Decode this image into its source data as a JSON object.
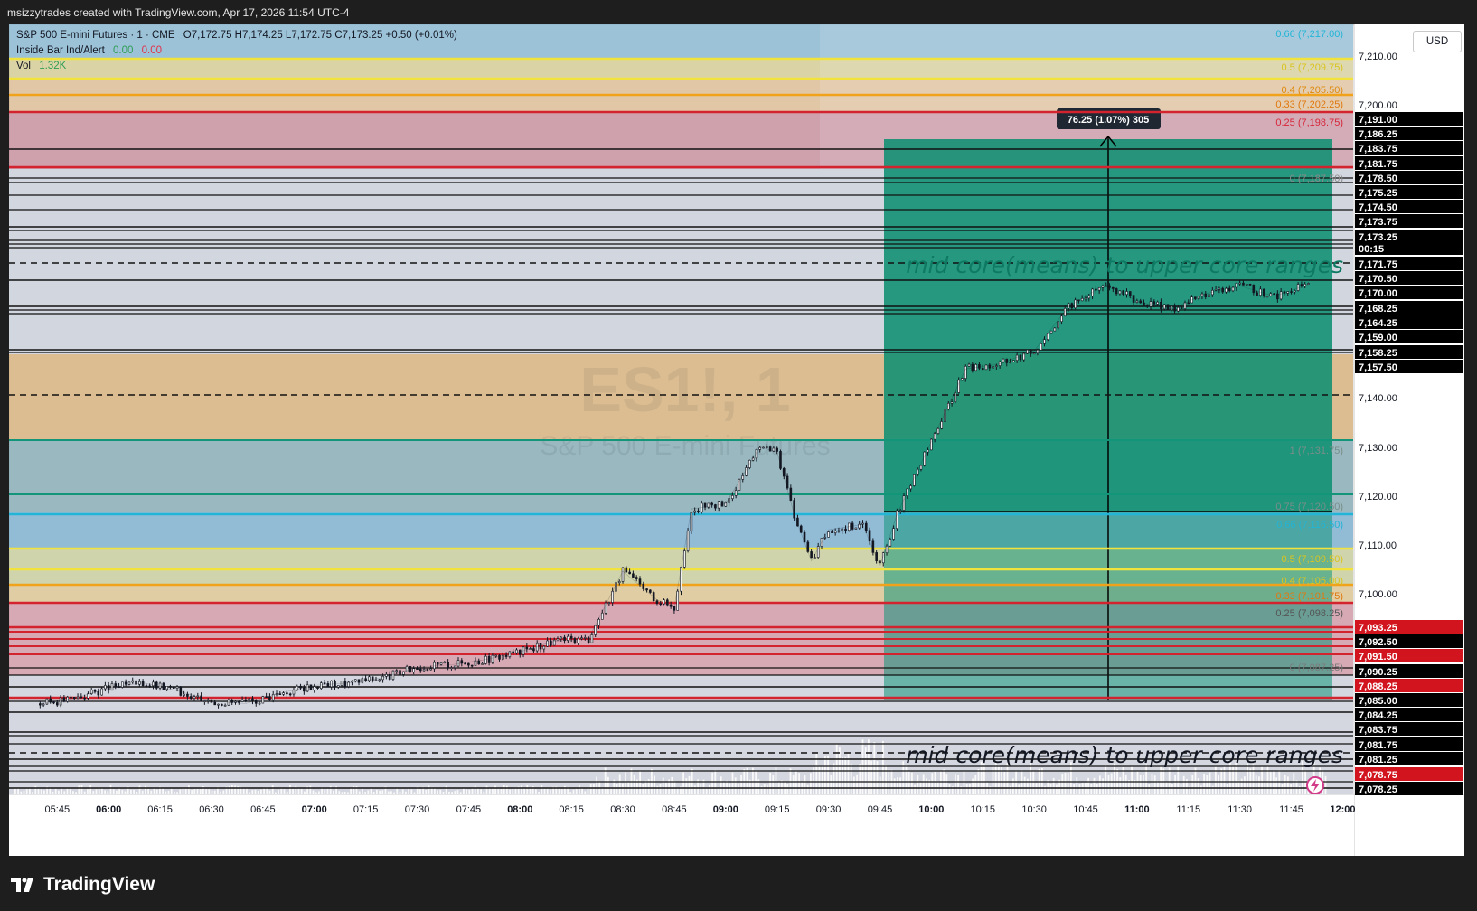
{
  "header": {
    "attribution": "msizzytrades created with TradingView.com, Apr 17, 2026 11:54 UTC-4"
  },
  "legend": {
    "symbol_line": "S&P 500 E-mini Futures · 1 · CME",
    "ohlc": "O7,172.75  H7,174.25  L7,172.75  C7,173.25  +0.50 (+0.01%)",
    "indicator_name": "Inside Bar Ind/Alert",
    "indicator_v1": "0.00",
    "indicator_v2": "0.00",
    "vol_label": "Vol",
    "vol_value": "1.32K"
  },
  "currency_button": "USD",
  "watermark": {
    "ticker": "ES1!, 1",
    "name": "S&P 500 E-mini Futures"
  },
  "position_tool": {
    "label": "76.25 (1.07%) 305"
  },
  "annotations": {
    "top_text": "mid core(means) to upper core ranges",
    "bottom_text": "mid core(means) to upper core ranges"
  },
  "fib_labels_top": [
    {
      "text": "0.66 (7,217.00)",
      "color": "#22b5d6"
    },
    {
      "text": "0.5 (7,209.75)",
      "color": "#d9c41e"
    },
    {
      "text": "0.4 (7,205.50)",
      "color": "#e08a0e"
    },
    {
      "text": "0.33 (7,202.25)",
      "color": "#e0780e"
    },
    {
      "text": "0.25 (7,198.75)",
      "color": "#d6263a"
    },
    {
      "text": "0 (7,187.50)",
      "color": "#8a8a8a"
    }
  ],
  "fib_labels_bottom": [
    {
      "text": "1 (7,131.75)",
      "color": "#7a8e8a"
    },
    {
      "text": "0.75 (7,120.50)",
      "color": "#7a8e8a"
    },
    {
      "text": "0.66 (7,116.50)",
      "color": "#22b5d6"
    },
    {
      "text": "0.5 (7,109.50)",
      "color": "#d9c41e"
    },
    {
      "text": "0.4 (7,105.00)",
      "color": "#d9c41e"
    },
    {
      "text": "0.33 (7,101.75)",
      "color": "#e0780e"
    },
    {
      "text": "0.25 (7,098.25)",
      "color": "#555555"
    },
    {
      "text": "0 (7,087.25)",
      "color": "#7a7a7a"
    }
  ],
  "price_axis": {
    "ticks": [
      "7,210.00",
      "7,200.00",
      "7,140.00",
      "7,130.00",
      "7,120.00",
      "7,110.00",
      "7,100.00"
    ],
    "tags": [
      {
        "text": "7,191.00",
        "bg": "#000000"
      },
      {
        "text": "7,186.25",
        "bg": "#000000"
      },
      {
        "text": "7,183.75",
        "bg": "#000000"
      },
      {
        "text": "7,181.75",
        "bg": "#000000"
      },
      {
        "text": "7,178.50",
        "bg": "#000000"
      },
      {
        "text": "7,175.25",
        "bg": "#000000"
      },
      {
        "text": "7,174.50",
        "bg": "#000000"
      },
      {
        "text": "7,173.75",
        "bg": "#000000"
      },
      {
        "text": "7,173.25",
        "bg": "#000000"
      },
      {
        "text": "00:15",
        "bg": "#000000"
      },
      {
        "text": "7,171.75",
        "bg": "#000000"
      },
      {
        "text": "7,170.50",
        "bg": "#000000"
      },
      {
        "text": "7,170.00",
        "bg": "#000000"
      },
      {
        "text": "7,168.25",
        "bg": "#000000"
      },
      {
        "text": "7,164.25",
        "bg": "#000000"
      },
      {
        "text": "7,159.00",
        "bg": "#000000"
      },
      {
        "text": "7,158.25",
        "bg": "#000000"
      },
      {
        "text": "7,157.50",
        "bg": "#000000"
      },
      {
        "text": "7,093.25",
        "bg": "#d1141e"
      },
      {
        "text": "7,092.50",
        "bg": "#000000"
      },
      {
        "text": "7,091.50",
        "bg": "#d1141e"
      },
      {
        "text": "7,090.25",
        "bg": "#000000"
      },
      {
        "text": "7,088.25",
        "bg": "#d1141e"
      },
      {
        "text": "7,085.00",
        "bg": "#000000"
      },
      {
        "text": "7,084.25",
        "bg": "#000000"
      },
      {
        "text": "7,083.75",
        "bg": "#000000"
      },
      {
        "text": "7,081.75",
        "bg": "#000000"
      },
      {
        "text": "7,081.25",
        "bg": "#000000"
      },
      {
        "text": "7,078.75",
        "bg": "#d1141e"
      },
      {
        "text": "7,078.25",
        "bg": "#000000"
      }
    ]
  },
  "time_axis": [
    "05:45",
    "06:00",
    "06:15",
    "06:30",
    "06:45",
    "07:00",
    "07:15",
    "07:30",
    "07:45",
    "08:00",
    "08:15",
    "08:30",
    "08:45",
    "09:00",
    "09:15",
    "09:30",
    "09:45",
    "10:00",
    "10:15",
    "10:30",
    "10:45",
    "11:00",
    "11:15",
    "11:30",
    "11:45",
    "12:00"
  ],
  "time_axis_bold": [
    "06:00",
    "07:00",
    "08:00",
    "09:00",
    "10:00",
    "11:00",
    "12:00"
  ],
  "brand": "TradingView",
  "chart_data": {
    "type": "line",
    "title": "S&P 500 E-mini Futures · 1 · CME",
    "xlabel": "",
    "ylabel": "",
    "ylim": [
      7075,
      7222
    ],
    "x": [
      "05:40",
      "05:50",
      "06:00",
      "06:10",
      "06:20",
      "06:30",
      "06:40",
      "06:50",
      "07:00",
      "07:10",
      "07:20",
      "07:30",
      "07:40",
      "07:50",
      "08:00",
      "08:10",
      "08:20",
      "08:30",
      "08:40",
      "08:45",
      "08:50",
      "09:00",
      "09:10",
      "09:15",
      "09:20",
      "09:25",
      "09:30",
      "09:40",
      "09:45",
      "09:50",
      "10:00",
      "10:10",
      "10:20",
      "10:30",
      "10:40",
      "10:50",
      "10:55",
      "11:00",
      "11:10",
      "11:20",
      "11:30",
      "11:40",
      "11:50"
    ],
    "series": [
      {
        "values": [
          7092.5,
          7093.5,
          7095.5,
          7096.5,
          7095.0,
          7093.0,
          7092.5,
          7094.5,
          7096.0,
          7096.5,
          7097.5,
          7099.5,
          7100.0,
          7101.0,
          7102.5,
          7104.5,
          7105.0,
          7118.0,
          7112.5,
          7111.0,
          7130.0,
          7131.0,
          7142.0,
          7141.0,
          7129.0,
          7120.0,
          7126.0,
          7127.0,
          7119.0,
          7129.0,
          7143.0,
          7157.0,
          7158.0,
          7160.5,
          7169.0,
          7173.0,
          7172.0,
          7170.0,
          7168.5,
          7171.5,
          7173.0,
          7171.0,
          7173.25
        ]
      }
    ]
  }
}
